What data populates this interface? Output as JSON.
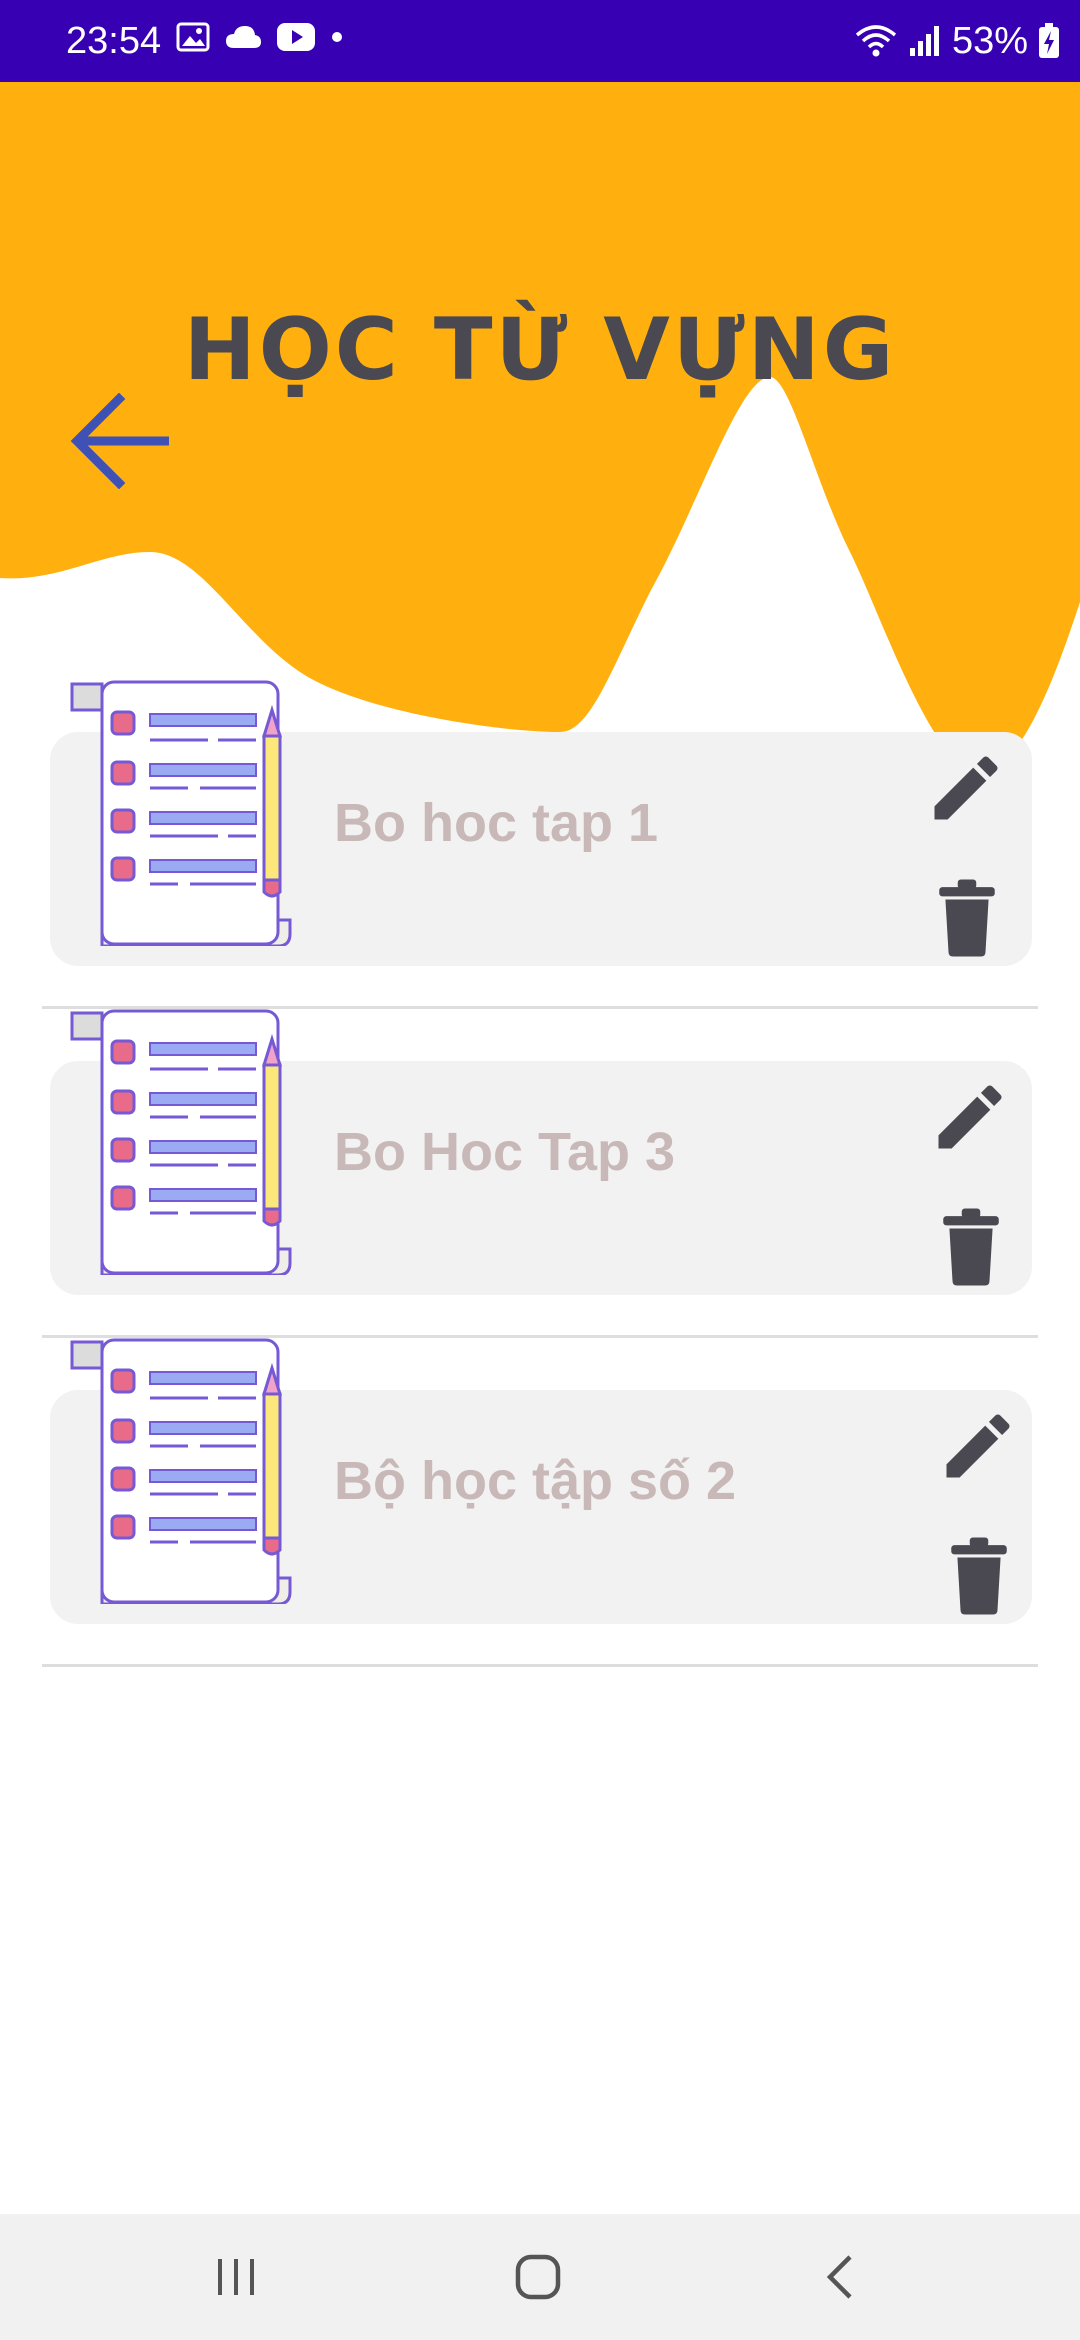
{
  "status_bar": {
    "time": "23:54",
    "battery": "53%",
    "left_icons": [
      "gallery-icon",
      "cloud-icon",
      "youtube-icon",
      "dot-icon"
    ],
    "right_icons": [
      "wifi-icon",
      "signal-icon",
      "battery-charging-icon"
    ]
  },
  "header": {
    "title": "HỌC TỪ VỰNG",
    "accent_color": "#ffb00f",
    "back_icon": "arrow-left-icon",
    "back_icon_color": "#3f51b5"
  },
  "vocab_sets": [
    {
      "title": "Bo hoc tap 1",
      "illustration": "checklist-scroll-icon",
      "edit_icon": "pencil-icon",
      "delete_icon": "trash-icon"
    },
    {
      "title": "Bo Hoc Tap 3",
      "illustration": "checklist-scroll-icon",
      "edit_icon": "pencil-icon",
      "delete_icon": "trash-icon"
    },
    {
      "title": "Bộ học tập số 2",
      "illustration": "checklist-scroll-icon",
      "edit_icon": "pencil-icon",
      "delete_icon": "trash-icon"
    }
  ],
  "nav_bar": {
    "buttons": [
      "recent-apps-icon",
      "home-icon",
      "back-icon"
    ]
  }
}
